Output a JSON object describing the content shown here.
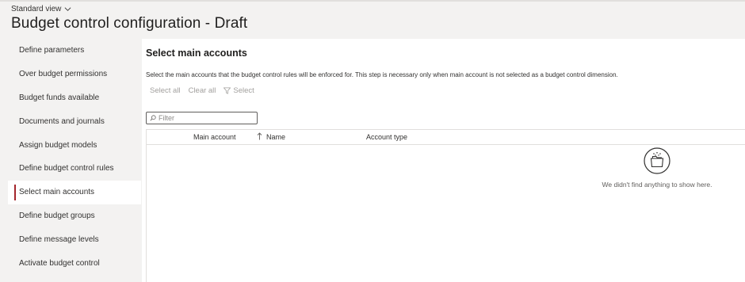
{
  "header": {
    "view_selector": "Standard view",
    "title": "Budget control configuration - Draft"
  },
  "sidebar": {
    "items": [
      {
        "label": "Define parameters"
      },
      {
        "label": "Over budget permissions"
      },
      {
        "label": "Budget funds available"
      },
      {
        "label": "Documents and journals"
      },
      {
        "label": "Assign budget models"
      },
      {
        "label": "Define budget control rules"
      },
      {
        "label": "Select main accounts",
        "active": true
      },
      {
        "label": "Define budget groups"
      },
      {
        "label": "Define message levels"
      },
      {
        "label": "Activate budget control"
      }
    ]
  },
  "main": {
    "title": "Select main accounts",
    "description": "Select the main accounts that the budget control rules will be enforced for. This step is necessary only when main account is not selected as a budget control dimension.",
    "actions": {
      "select_all": "Select all",
      "clear_all": "Clear all",
      "select": "Select"
    },
    "filter": {
      "placeholder": "Filter",
      "value": ""
    },
    "grid": {
      "columns": [
        "Main account",
        "Name",
        "Account type"
      ],
      "sort_column": "Main account",
      "sort_direction": "ascending"
    },
    "empty_state": {
      "icon": "empty-folder-icon",
      "message": "We didn't find anything to show here."
    }
  },
  "colors": {
    "accent": "#a4262c",
    "background": "#f3f2f1",
    "disabled_text": "#a19f9d"
  }
}
